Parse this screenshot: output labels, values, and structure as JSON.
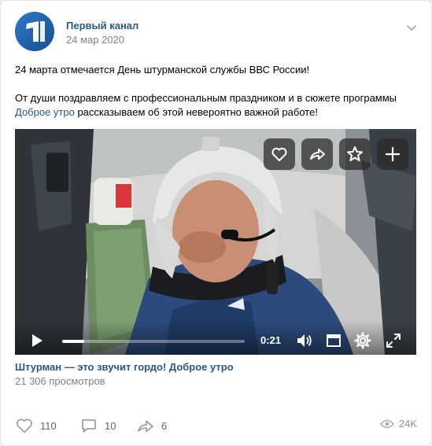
{
  "post": {
    "author": "Первый канал",
    "date": "24 мар 2020",
    "paragraph1": "24 марта отмечается День штурманской службы ВВС России!",
    "paragraph2_before": "От души поздравляем с профессиональным праздником и в сюжете программы ",
    "paragraph2_link": "Доброе утро",
    "paragraph2_after": " рассказываем об этой невероятно важной работе!"
  },
  "video": {
    "time": "0:21",
    "progress_fraction": 0.12,
    "title": "Штурман — это звучит гордо! Доброе утро",
    "views": "21 306 просмотров"
  },
  "footer": {
    "likes": "110",
    "comments": "10",
    "shares": "6",
    "views": "24K"
  },
  "colors": {
    "link": "#2a5885",
    "muted": "#828282",
    "logo_bg": "#1f5fa8"
  }
}
